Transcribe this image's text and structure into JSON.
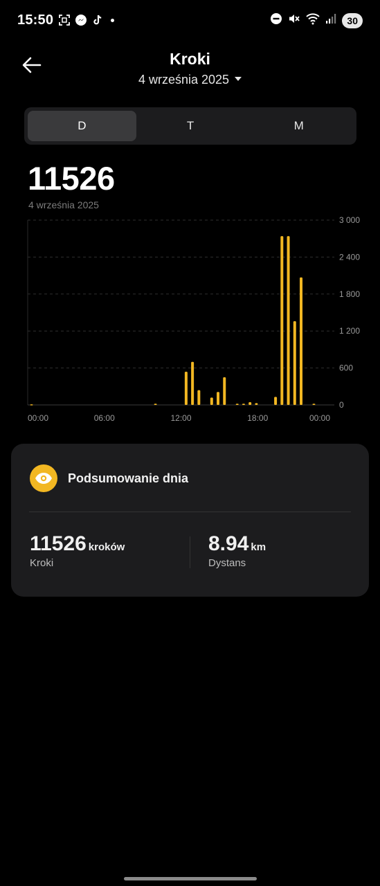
{
  "status_bar": {
    "time": "15:50",
    "battery": "30",
    "left_icons": [
      "screenshot-icon",
      "messenger-icon",
      "tiktok-icon",
      "notification-dot"
    ],
    "right_icons": [
      "dnd-icon",
      "mute-icon",
      "wifi-icon",
      "signal-icon"
    ]
  },
  "header": {
    "title": "Kroki",
    "date": "4 września 2025"
  },
  "segments": [
    {
      "label": "D",
      "active": true
    },
    {
      "label": "T",
      "active": false
    },
    {
      "label": "M",
      "active": false
    }
  ],
  "summary_top": {
    "value": "11526",
    "date": "4 września 2025"
  },
  "chart_data": {
    "type": "bar",
    "xlabel": "",
    "ylabel": "",
    "x_ticks": [
      "00:00",
      "06:00",
      "12:00",
      "18:00",
      "00:00"
    ],
    "y_ticks": [
      "3 000",
      "2 400",
      "1 800",
      "1 200",
      "600",
      "0"
    ],
    "ylim": [
      0,
      3000
    ],
    "grid": true,
    "bar_color": "#f2b722",
    "hours": [
      0.3,
      10.0,
      12.4,
      12.9,
      13.4,
      14.4,
      14.9,
      15.4,
      16.4,
      16.9,
      17.4,
      17.9,
      19.4,
      19.9,
      20.4,
      20.9,
      21.4,
      22.4
    ],
    "values": [
      10,
      20,
      540,
      700,
      240,
      120,
      210,
      450,
      20,
      20,
      45,
      30,
      130,
      2740,
      2740,
      1360,
      2070,
      20
    ]
  },
  "card": {
    "title": "Podsumowanie dnia",
    "icon": "eye-icon",
    "steps_value": "11526",
    "steps_unit": "kroków",
    "steps_label": "Kroki",
    "distance_value": "8.94",
    "distance_unit": "km",
    "distance_label": "Dystans"
  },
  "colors": {
    "accent": "#f2b722",
    "card_bg": "#1c1c1e",
    "bg": "#000000"
  }
}
